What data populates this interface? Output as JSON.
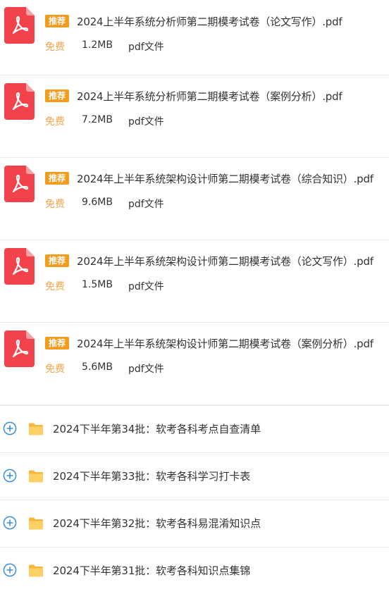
{
  "files": [
    {
      "badge": "推荐",
      "name": "2024上半年系统分析师第二期模考试卷（论文写作）.pdf",
      "price": "免费",
      "size": "1.2MB",
      "type": "pdf文件",
      "icon": "pdf-file-icon"
    },
    {
      "badge": "推荐",
      "name": "2024上半年系统分析师第二期模考试卷（案例分析）.pdf",
      "price": "免费",
      "size": "7.2MB",
      "type": "pdf文件",
      "icon": "pdf-file-icon"
    },
    {
      "badge": "推荐",
      "name": "2024年上半年系统架构设计师第二期模考试卷（综合知识）.pdf",
      "price": "免费",
      "size": "9.6MB",
      "type": "pdf文件",
      "icon": "pdf-file-icon"
    },
    {
      "badge": "推荐",
      "name": "2024年上半年系统架构设计师第二期模考试卷（论文写作）.pdf",
      "price": "免费",
      "size": "1.5MB",
      "type": "pdf文件",
      "icon": "pdf-file-icon"
    },
    {
      "badge": "推荐",
      "name": "2024年上半年系统架构设计师第二期模考试卷（案例分析）.pdf",
      "price": "免费",
      "size": "5.6MB",
      "type": "pdf文件",
      "icon": "pdf-file-icon"
    }
  ],
  "folders": [
    {
      "name": "2024下半年第34批：软考各科考点自查清单",
      "expand_icon": "plus-circle-icon",
      "icon": "folder-icon"
    },
    {
      "name": "2024下半年第33批：软考各科学习打卡表",
      "expand_icon": "plus-circle-icon",
      "icon": "folder-icon"
    },
    {
      "name": "2024下半年第32批：软考各科易混淆知识点",
      "expand_icon": "plus-circle-icon",
      "icon": "folder-icon"
    },
    {
      "name": "2024下半年第31批：软考各科知识点集锦",
      "expand_icon": "plus-circle-icon",
      "icon": "folder-icon"
    }
  ],
  "colors": {
    "badge": "#f39b1d",
    "free_text": "#f0a64b",
    "pdf_icon": "#f2434c",
    "folder": "#fbc44a",
    "plus": "#3a8fd6",
    "divider": "#ececec"
  }
}
